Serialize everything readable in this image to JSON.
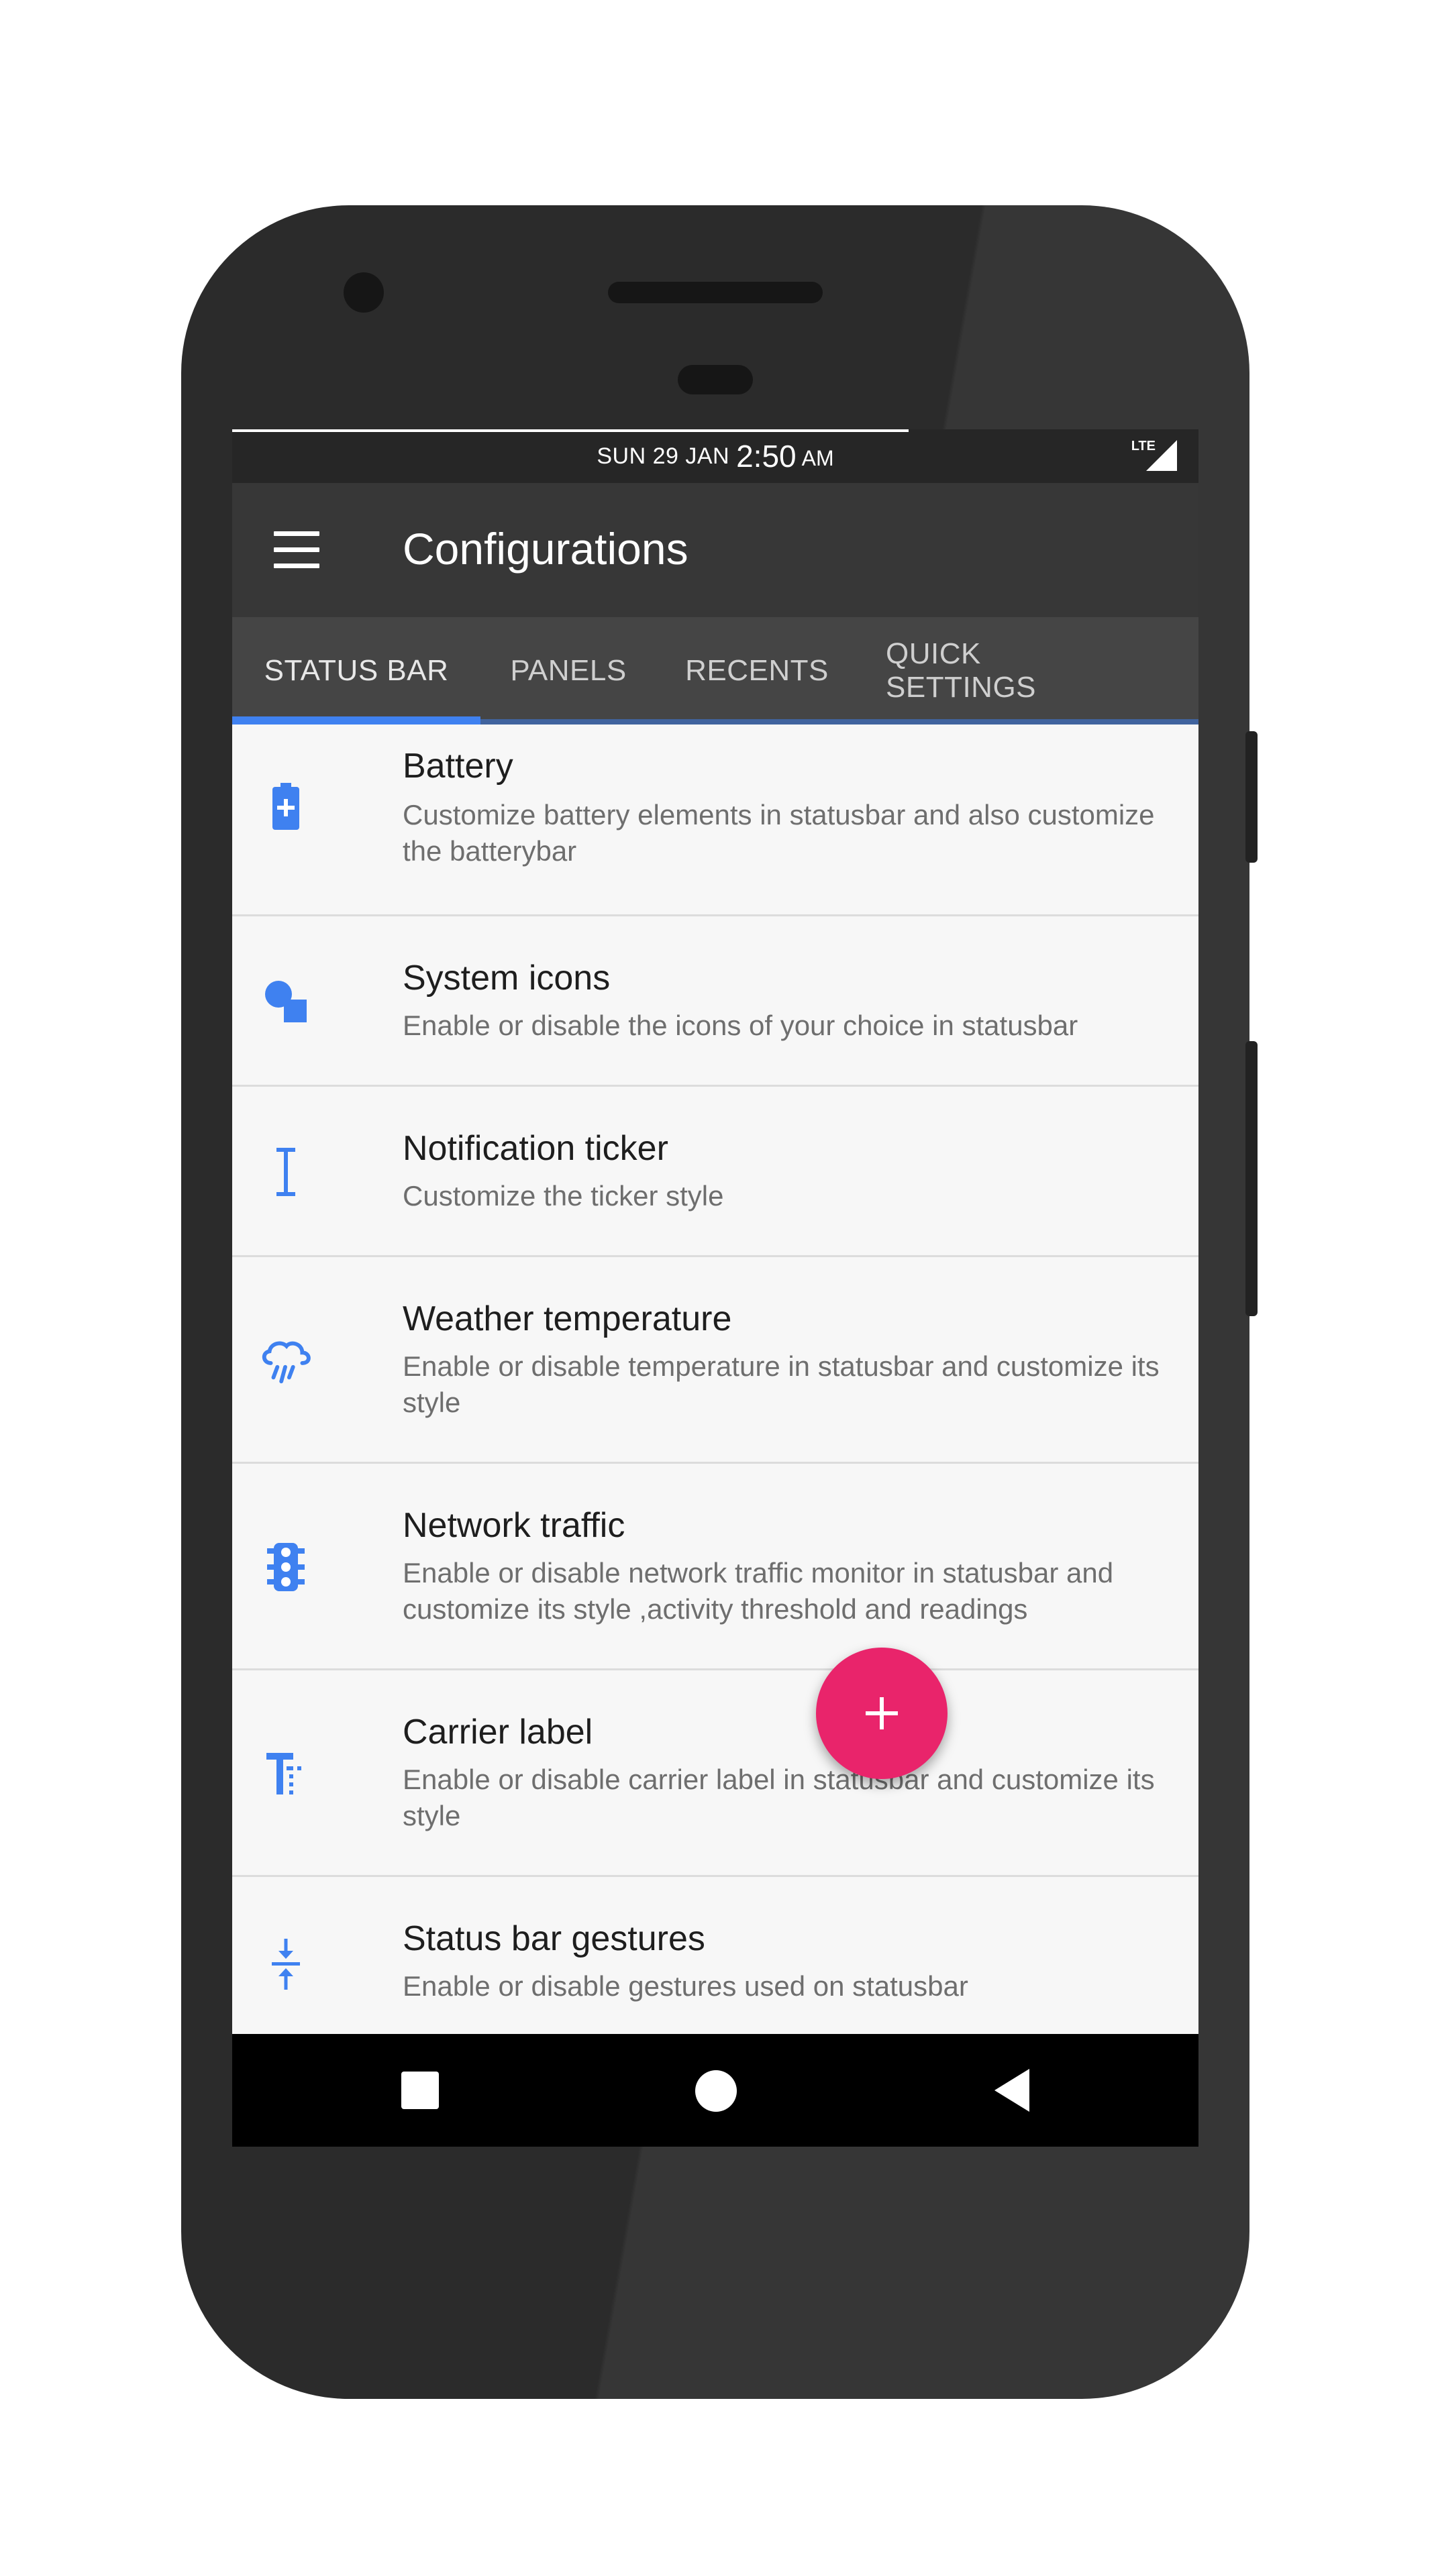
{
  "status_bar": {
    "date": "SUN 29 JAN",
    "time": "2:50",
    "ampm": "AM",
    "network": "LTE"
  },
  "app_bar": {
    "title": "Configurations",
    "menu_icon": "hamburger-menu-icon"
  },
  "tabs": [
    {
      "label": "STATUS BAR",
      "active": true
    },
    {
      "label": "PANELS",
      "active": false
    },
    {
      "label": "RECENTS",
      "active": false
    },
    {
      "label": "QUICK SETTINGS",
      "active": false
    }
  ],
  "items": [
    {
      "icon": "battery-icon",
      "title": "Battery",
      "subtitle": "Customize battery elements in statusbar and also customize the batterybar"
    },
    {
      "icon": "shapes-icon",
      "title": "System icons",
      "subtitle": "Enable or disable the icons of your choice in statusbar"
    },
    {
      "icon": "text-cursor-icon",
      "title": "Notification ticker",
      "subtitle": "Customize the ticker style"
    },
    {
      "icon": "weather-rain-icon",
      "title": "Weather temperature",
      "subtitle": "Enable or disable temperature in statusbar and customize its style"
    },
    {
      "icon": "traffic-light-icon",
      "title": "Network traffic",
      "subtitle": "Enable or disable network traffic monitor in statusbar and customize its style ,activity threshold and readings"
    },
    {
      "icon": "text-format-icon",
      "title": "Carrier label",
      "subtitle": "Enable or disable carrier label in statusbar and customize its style"
    },
    {
      "icon": "vertical-compress-icon",
      "title": "Status bar gestures",
      "subtitle": "Enable or disable gestures used on statusbar"
    }
  ],
  "fab": {
    "icon": "plus-icon"
  },
  "colors": {
    "accent": "#3f81f0",
    "fab": "#e9246b",
    "app_bar": "#373737",
    "tab_bar": "#454545"
  }
}
